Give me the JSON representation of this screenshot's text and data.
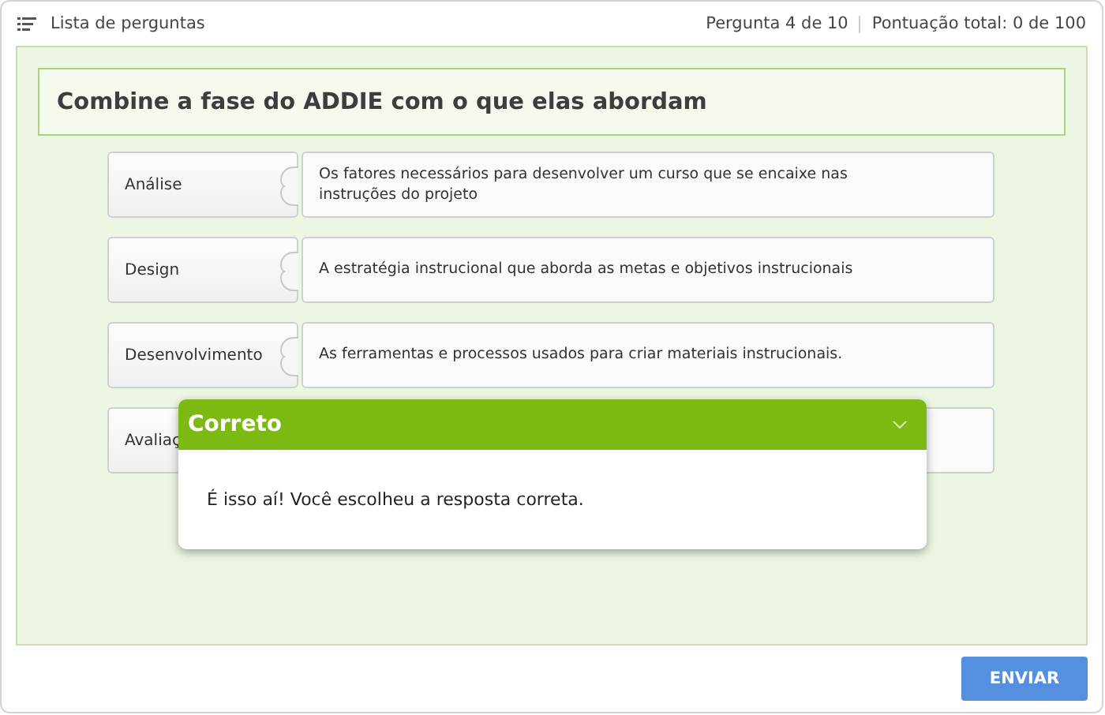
{
  "header": {
    "menu_label": "Lista de perguntas",
    "progress": "Pergunta 4 de 10",
    "score": "Pontuação total: 0 de 100"
  },
  "question": {
    "title": "Combine a fase do ADDIE com o que elas abordam"
  },
  "pairs": [
    {
      "term": "Análise",
      "match": "Os fatores necessários para desenvolver um curso que se encaixe nas instruções do projeto"
    },
    {
      "term": "Design",
      "match": "A estratégia instrucional que aborda as metas e objetivos instrucionais"
    },
    {
      "term": "Desenvolvimento",
      "match": "As ferramentas e processos usados para criar materiais instrucionais."
    },
    {
      "term": "Avaliaç"
    }
  ],
  "feedback": {
    "title": "Correto",
    "message": "É isso aí! Você escolheu a resposta correta."
  },
  "submit_button": "ENVIAR"
}
